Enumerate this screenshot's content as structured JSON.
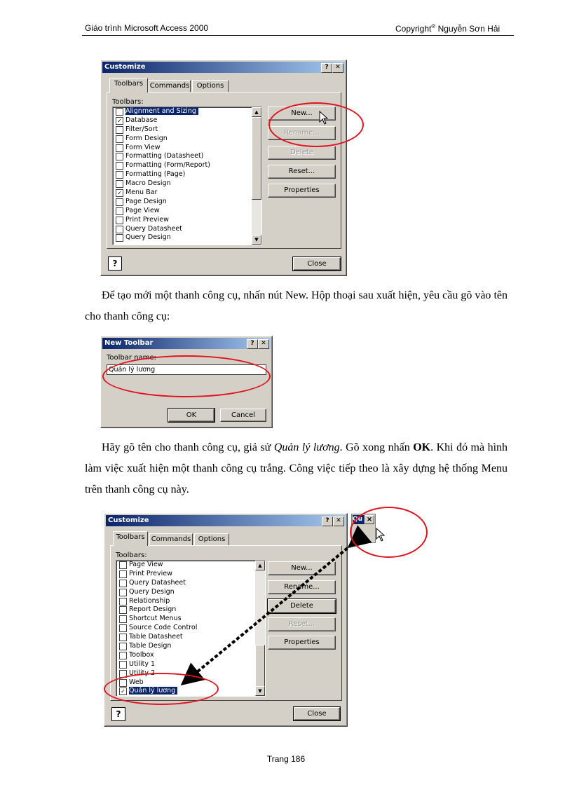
{
  "header": {
    "left": "Giáo trình Microsoft Access 2000",
    "right_prefix": "Copyright",
    "right_suffix": " Nguyễn Sơn Hải",
    "registered": "®"
  },
  "dialog1": {
    "title": "Customize",
    "help_btn": "?",
    "close_btn": "✕",
    "tabs": [
      "Toolbars",
      "Commands",
      "Options"
    ],
    "list_label": "Toolbars:",
    "items": [
      {
        "label": "Alignment and Sizing",
        "checked": false,
        "selected": true
      },
      {
        "label": "Database",
        "checked": true,
        "selected": false
      },
      {
        "label": "Filter/Sort",
        "checked": false,
        "selected": false
      },
      {
        "label": "Form Design",
        "checked": false,
        "selected": false
      },
      {
        "label": "Form View",
        "checked": false,
        "selected": false
      },
      {
        "label": "Formatting (Datasheet)",
        "checked": false,
        "selected": false
      },
      {
        "label": "Formatting (Form/Report)",
        "checked": false,
        "selected": false
      },
      {
        "label": "Formatting (Page)",
        "checked": false,
        "selected": false
      },
      {
        "label": "Macro Design",
        "checked": false,
        "selected": false
      },
      {
        "label": "Menu Bar",
        "checked": true,
        "selected": false
      },
      {
        "label": "Page Design",
        "checked": false,
        "selected": false
      },
      {
        "label": "Page View",
        "checked": false,
        "selected": false
      },
      {
        "label": "Print Preview",
        "checked": false,
        "selected": false
      },
      {
        "label": "Query Datasheet",
        "checked": false,
        "selected": false
      },
      {
        "label": "Query Design",
        "checked": false,
        "selected": false
      }
    ],
    "buttons": [
      "New...",
      "Rename...",
      "Delete",
      "Reset...",
      "Properties"
    ],
    "close_label": "Close"
  },
  "paragraph1": "Để tạo mới một thanh công cụ, nhấn nút New. Hộp thoại sau xuất hiện, yêu cầu gõ vào tên cho thanh công cụ:",
  "dialog2": {
    "title": "New Toolbar",
    "help_btn": "?",
    "close_btn": "✕",
    "field_label": "Toolbar name:",
    "field_value": "Quản lý lương",
    "ok_label": "OK",
    "cancel_label": "Cancel"
  },
  "paragraph2": {
    "before": "Hãy gõ tên cho thanh công cụ, giả sử ",
    "italic": "Quản lý lương",
    "middle": ". Gõ xong nhấn ",
    "bold": "OK",
    "after": ". Khi đó mà hình làm việc xuất hiện một thanh công cụ trắng. Công việc tiếp theo là xây dựng hệ thống Menu trên thanh công cụ này."
  },
  "dialog3": {
    "title": "Customize",
    "help_btn": "?",
    "close_btn": "✕",
    "tabs": [
      "Toolbars",
      "Commands",
      "Options"
    ],
    "list_label": "Toolbars:",
    "items": [
      {
        "label": "Page View",
        "checked": false,
        "selected": false
      },
      {
        "label": "Print Preview",
        "checked": false,
        "selected": false
      },
      {
        "label": "Query Datasheet",
        "checked": false,
        "selected": false
      },
      {
        "label": "Query Design",
        "checked": false,
        "selected": false
      },
      {
        "label": "Relationship",
        "checked": false,
        "selected": false
      },
      {
        "label": "Report Design",
        "checked": false,
        "selected": false
      },
      {
        "label": "Shortcut Menus",
        "checked": false,
        "selected": false
      },
      {
        "label": "Source Code Control",
        "checked": false,
        "selected": false
      },
      {
        "label": "Table Datasheet",
        "checked": false,
        "selected": false
      },
      {
        "label": "Table Design",
        "checked": false,
        "selected": false
      },
      {
        "label": "Toolbox",
        "checked": false,
        "selected": false
      },
      {
        "label": "Utility 1",
        "checked": false,
        "selected": false
      },
      {
        "label": "Utility 2",
        "checked": false,
        "selected": false
      },
      {
        "label": "Web",
        "checked": false,
        "selected": false
      },
      {
        "label": "Quản lý lương",
        "checked": true,
        "selected": true
      }
    ],
    "buttons": [
      "New...",
      "Rename...",
      "Delete",
      "Reset...",
      "Properties"
    ],
    "close_label": "Close",
    "floating_toolbar_title": "Qu"
  },
  "footer": "Trang 186"
}
